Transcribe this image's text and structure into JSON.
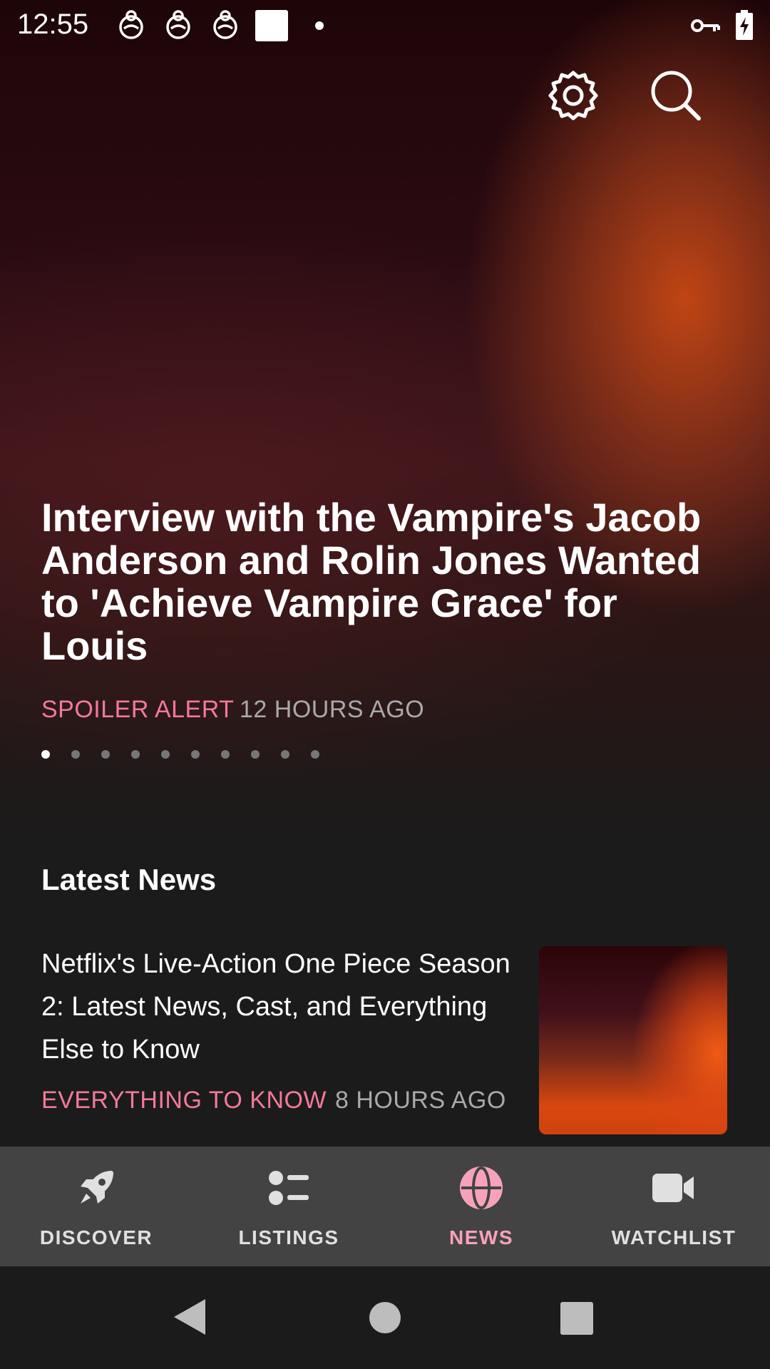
{
  "status_bar": {
    "time": "12:55"
  },
  "toolbar": {
    "settings_icon": "gear-icon",
    "search_icon": "search-icon"
  },
  "hero": {
    "title": "Interview with the Vampire's Jacob Anderson and Rolin Jones Wanted to 'Achieve Vampire Grace' for Louis",
    "tag": "SPOILER ALERT",
    "time": "12 HOURS AGO",
    "carousel_total": 10,
    "carousel_active": 1
  },
  "latest": {
    "title": "Latest News",
    "articles": [
      {
        "title": "Netflix's Live-Action One Piece Season 2: Latest News, Cast, and Everything Else to Know",
        "tag": "EVERYTHING TO KNOW",
        "time": "8 HOURS AGO"
      }
    ]
  },
  "bottom_nav": {
    "items": [
      {
        "label": "DISCOVER",
        "icon": "rocket-icon"
      },
      {
        "label": "LISTINGS",
        "icon": "list-icon"
      },
      {
        "label": "NEWS",
        "icon": "globe-icon"
      },
      {
        "label": "WATCHLIST",
        "icon": "video-camera-icon"
      }
    ],
    "active_index": 2
  },
  "colors": {
    "accent_pink": "#f27a98",
    "nav_active": "#f7a2bb",
    "nav_bg": "#434343",
    "background": "#1b1b1b"
  }
}
